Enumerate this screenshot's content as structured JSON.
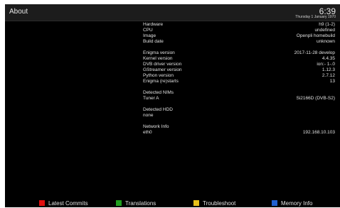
{
  "header": {
    "title": "About",
    "time": "6:39",
    "date": "Thursday  1 January 1970"
  },
  "info": {
    "hardware": {
      "label": "Hardware",
      "value": "h9 (1-2)"
    },
    "cpu": {
      "label": "CPU",
      "value": "undefined"
    },
    "image": {
      "label": "Image",
      "value": "Openpli homebuild"
    },
    "build_date": {
      "label": "Build date",
      "value": "unknown"
    },
    "enigma_version": {
      "label": "Enigma version",
      "value": "2017-11-28 develop"
    },
    "kernel_version": {
      "label": "Kernel version",
      "value": "4.4.35"
    },
    "dvb_driver_version": {
      "label": "DVB driver version",
      "value": "ion:- 1-.0"
    },
    "gstreamer_version": {
      "label": "GStreamer version",
      "value": "1.12.3"
    },
    "python_version": {
      "label": "Python version",
      "value": "2.7.12"
    },
    "enigma_restarts": {
      "label": "Enigma (re)starts",
      "value": "13"
    },
    "detected_nims_heading": "Detected NIMs",
    "tuner_a": {
      "label": "Tuner A",
      "value": "Si2166D (DVB-S2)"
    },
    "detected_hdd_heading": "Detected HDD",
    "hdd_none": "none",
    "network_heading": "Network Info",
    "eth0": {
      "label": "eth0",
      "value": "192.168.10.103"
    }
  },
  "buttons": {
    "red": {
      "label": "Latest Commits",
      "color": "#e01010"
    },
    "green": {
      "label": "Translations",
      "color": "#1fa01f"
    },
    "yellow": {
      "label": "Troubleshoot",
      "color": "#e6c01a"
    },
    "blue": {
      "label": "Memory Info",
      "color": "#2060d0"
    }
  }
}
